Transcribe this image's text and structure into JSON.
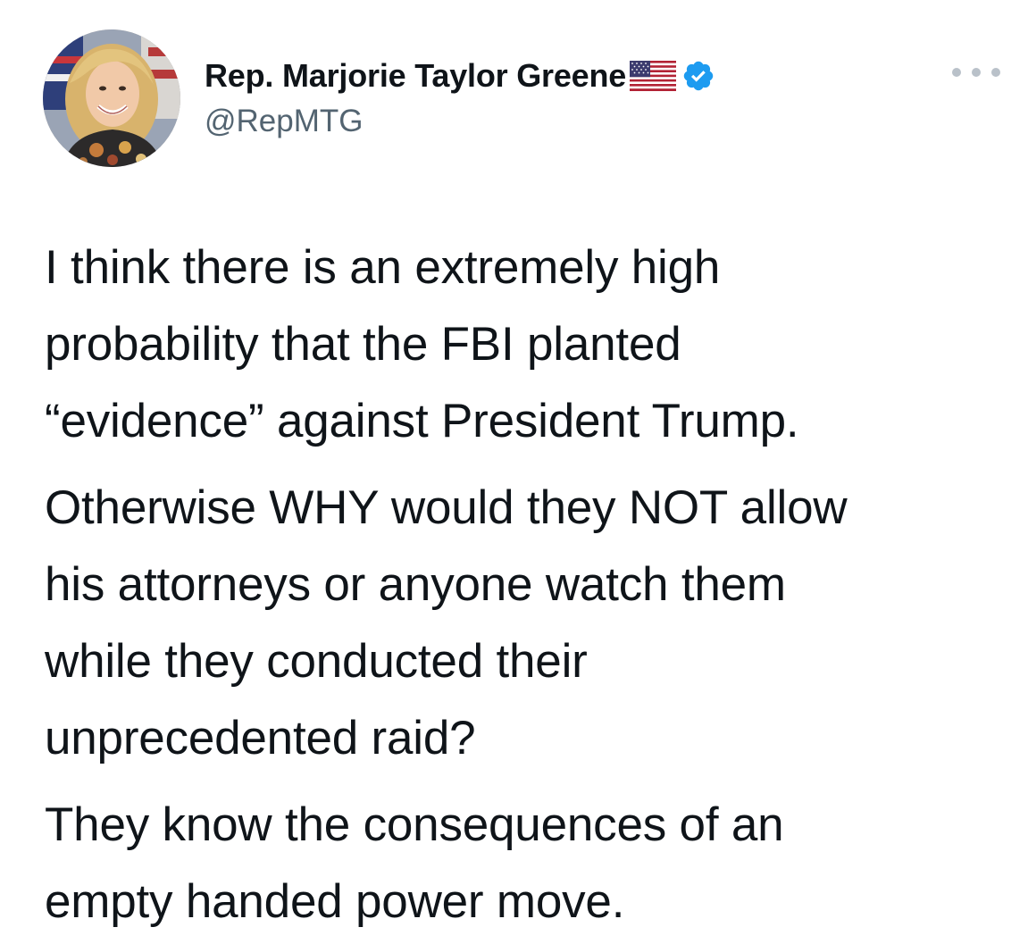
{
  "tweet": {
    "author": {
      "display_name": "Rep. Marjorie Taylor Greene",
      "handle": "@RepMTG",
      "flag_icon": "us-flag-emoji",
      "verified_icon": "verified-badge-icon",
      "verified_color": "#1d9bf0"
    },
    "more_icon": "more-options-icon",
    "paragraphs": [
      "I think there is an extremely high\nprobability that the FBI planted\n“evidence” against President Trump.",
      "Otherwise WHY would they NOT allow\nhis attorneys or anyone watch them\nwhile they conducted their\nunprecedented raid?",
      "They know the consequences of an\nempty handed power move."
    ]
  },
  "colors": {
    "text": "#0f1419",
    "secondary": "#536471",
    "accent": "#1d9bf0",
    "background": "#ffffff"
  }
}
